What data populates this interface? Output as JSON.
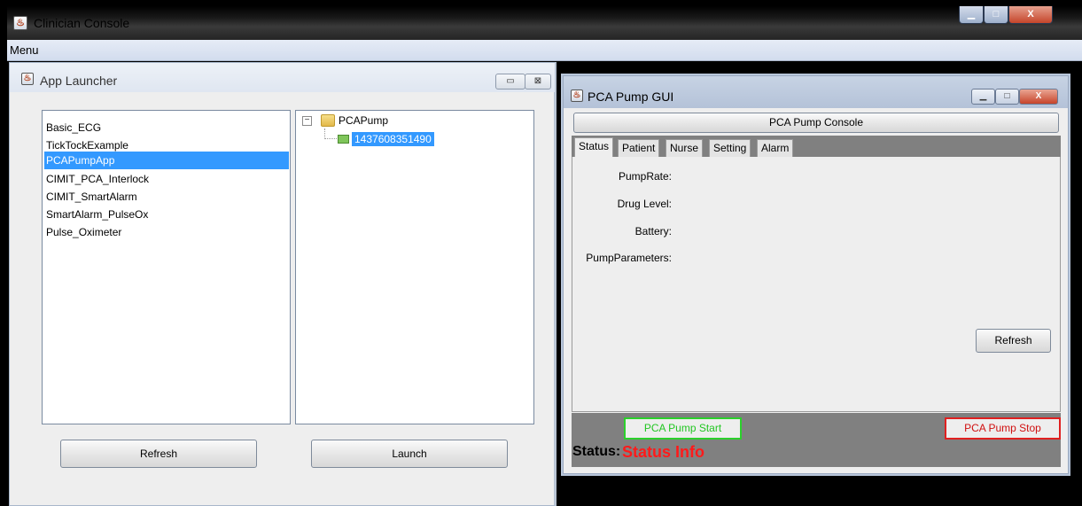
{
  "main_window": {
    "title": "Clinician Console",
    "controls": {
      "minimize": "▁",
      "maximize": "□",
      "close": "X"
    }
  },
  "menubar": {
    "menu_label": "Menu"
  },
  "app_launcher": {
    "title": "App Launcher",
    "apps": [
      "Basic_ECG",
      "TickTockExample",
      "PCAPumpApp",
      "CIMIT_PCA_Interlock",
      "CIMIT_SmartAlarm",
      "SmartAlarm_PulseOx",
      "Pulse_Oximeter"
    ],
    "selected_app": "PCAPumpApp",
    "tree": {
      "root": "PCAPump",
      "child": "1437608351490",
      "expander": "−"
    },
    "refresh_label": "Refresh",
    "launch_label": "Launch"
  },
  "pca_gui": {
    "title": "PCA Pump GUI",
    "console_button": "PCA Pump Console",
    "tabs": [
      "Status",
      "Patient",
      "Nurse",
      "Setting",
      "Alarm"
    ],
    "active_tab": "Status",
    "fields": {
      "pump_rate": "PumpRate:",
      "drug_level": "Drug Level:",
      "battery": "Battery:",
      "pump_parameters": "PumpParameters:"
    },
    "refresh_label": "Refresh",
    "start_label": "PCA Pump Start",
    "stop_label": "PCA Pump Stop",
    "status_label": "Status:",
    "status_value": "Status Info"
  },
  "colors": {
    "selection": "#3399ff",
    "start_green": "#22c622",
    "stop_red": "#d01010",
    "status_red": "#ff1a1a",
    "panel_gray": "#808080"
  }
}
